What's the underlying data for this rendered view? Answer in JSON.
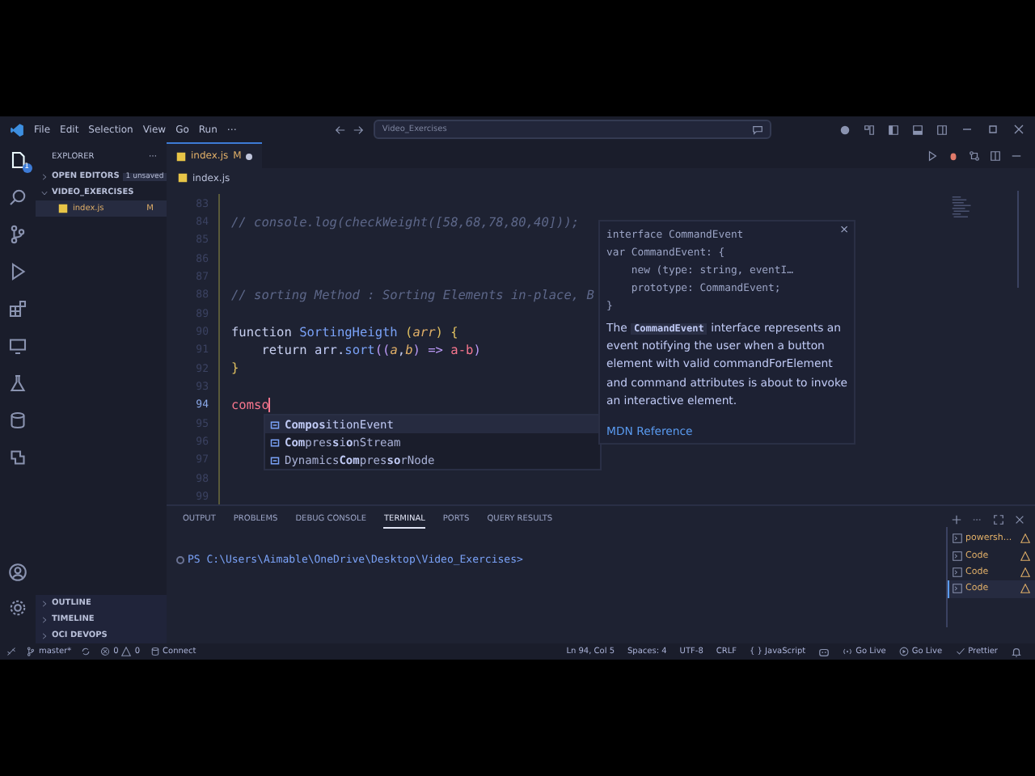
{
  "title_bar": {
    "menu": [
      "File",
      "Edit",
      "Selection",
      "View",
      "Go",
      "Run",
      "⋯"
    ],
    "search": "Video_Exercises"
  },
  "activity_bar": {
    "items": [
      {
        "kind": "files",
        "badge": "1",
        "selected": true
      },
      {
        "kind": "search",
        "selected": false
      },
      {
        "kind": "branch",
        "selected": false
      },
      {
        "kind": "run",
        "selected": false
      },
      {
        "kind": "blocks",
        "selected": false
      },
      {
        "kind": "monitor",
        "selected": false
      },
      {
        "kind": "flask",
        "selected": false
      },
      {
        "kind": "database",
        "selected": false
      },
      {
        "kind": "plugin",
        "selected": false
      }
    ],
    "bottom": [
      {
        "kind": "account"
      },
      {
        "kind": "gear"
      }
    ]
  },
  "sidebar": {
    "title": "EXPLORER",
    "more": "⋯",
    "sections": [
      {
        "label": "OPEN EDITORS",
        "expanded": false,
        "badge": "1 unsaved"
      },
      {
        "label": "VIDEO_EXERCISES",
        "expanded": true,
        "files": [
          {
            "name": "index.js",
            "status": "M"
          }
        ]
      }
    ],
    "bottom_sections": [
      {
        "label": "OUTLINE",
        "expanded": false
      },
      {
        "label": "TIMELINE",
        "expanded": false
      },
      {
        "label": "OCI DEVOPS",
        "expanded": false
      }
    ]
  },
  "editor": {
    "tabs": [
      {
        "label": "index.js",
        "status": "M",
        "modified": true,
        "selected": true
      }
    ],
    "breadcrumb": "index.js",
    "lines": [
      {
        "number": "83",
        "current": false
      },
      {
        "number": "84",
        "current": false,
        "tokens": [
          {
            "kind": "comment",
            "text": "// console.log(checkWeight([58,68,78,80,40]));"
          }
        ]
      },
      {
        "number": "85",
        "current": false
      },
      {
        "number": "86",
        "current": false
      },
      {
        "number": "87",
        "current": false
      },
      {
        "number": "88",
        "current": false,
        "tokens": [
          {
            "kind": "comment",
            "text": "// sorting Method : Sorting Elements in-place, B"
          }
        ]
      },
      {
        "number": "89",
        "current": false
      },
      {
        "number": "90",
        "current": false,
        "tokens": [
          {
            "kind": "keyword",
            "text": "function "
          },
          {
            "kind": "function",
            "text": "SortingHeigth "
          },
          {
            "kind": "brace",
            "text": "("
          },
          {
            "kind": "param",
            "text": "arr"
          },
          {
            "kind": "brace",
            "text": ") {"
          }
        ]
      },
      {
        "number": "91",
        "current": false,
        "tokens": [
          {
            "kind": "keyword",
            "text": "    return "
          },
          {
            "kind": "plain",
            "text": "arr."
          },
          {
            "kind": "function",
            "text": "sort"
          },
          {
            "kind": "paren",
            "text": "(("
          },
          {
            "kind": "param",
            "text": "a"
          },
          {
            "kind": "plain",
            "text": ","
          },
          {
            "kind": "param",
            "text": "b"
          },
          {
            "kind": "paren",
            "text": ")"
          },
          {
            "kind": "operator",
            "text": " => "
          },
          {
            "kind": "ident",
            "text": "a-b"
          },
          {
            "kind": "paren",
            "text": ")"
          }
        ]
      },
      {
        "number": "92",
        "current": false,
        "tokens": [
          {
            "kind": "brace",
            "text": "}"
          }
        ]
      },
      {
        "number": "93",
        "current": false
      },
      {
        "number": "94",
        "current": true,
        "tokens": [
          {
            "kind": "ident",
            "text": "comso"
          }
        ]
      },
      {
        "number": "95",
        "current": false
      },
      {
        "number": "96",
        "current": false
      },
      {
        "number": "97",
        "current": false
      },
      {
        "number": "98",
        "current": false
      },
      {
        "number": "99",
        "current": false
      }
    ],
    "suggestions": [
      {
        "label": "**Compos**itionEvent",
        "selected": true
      },
      {
        "label": "**Com**pres**s**i**o**nStream",
        "selected": false
      },
      {
        "label": "Dynamics**Com**pres**so**rNode",
        "selected": false
      }
    ],
    "details": {
      "signature": [
        "interface CommandEvent",
        "var CommandEvent: {",
        "    new (type: string, eventI…",
        "    prototype: CommandEvent;",
        "}"
      ],
      "description": "The **CommandEvent** interface represents an event notifying the user when a button element with valid commandForElement and command attributes is about to invoke an interactive element.",
      "link": "MDN Reference",
      "close": "×"
    }
  },
  "panel": {
    "tabs": [
      {
        "label": "OUTPUT",
        "selected": false
      },
      {
        "label": "PROBLEMS",
        "selected": false
      },
      {
        "label": "DEBUG CONSOLE",
        "selected": false
      },
      {
        "label": "TERMINAL",
        "selected": true
      },
      {
        "label": "PORTS",
        "selected": false
      },
      {
        "label": "QUERY RESULTS",
        "selected": false
      }
    ],
    "terminal_line": "PS C:\\Users\\Aimable\\OneDrive\\Desktop\\Video_Exercises>",
    "terminals": [
      {
        "label": "powersh...",
        "selected": false
      },
      {
        "label": "Code",
        "selected": false
      },
      {
        "label": "Code",
        "selected": false
      },
      {
        "label": "Code",
        "selected": true
      }
    ]
  },
  "status_bar": {
    "branch": "master*",
    "errors": "0",
    "warnings": "0",
    "connect": "Connect",
    "right": [
      {
        "kind": "text",
        "text": "Ln 94, Col 5"
      },
      {
        "kind": "text",
        "text": "Spaces: 4"
      },
      {
        "kind": "text",
        "text": "UTF-8"
      },
      {
        "kind": "text",
        "text": "CRLF"
      },
      {
        "kind": "text",
        "text": "{ } JavaScript"
      },
      {
        "kind": "copilot"
      },
      {
        "kind": "broadcast",
        "text": "Go Live"
      },
      {
        "kind": "play",
        "text": "Go Live"
      },
      {
        "kind": "check",
        "text": "Prettier"
      },
      {
        "kind": "bell"
      }
    ]
  }
}
